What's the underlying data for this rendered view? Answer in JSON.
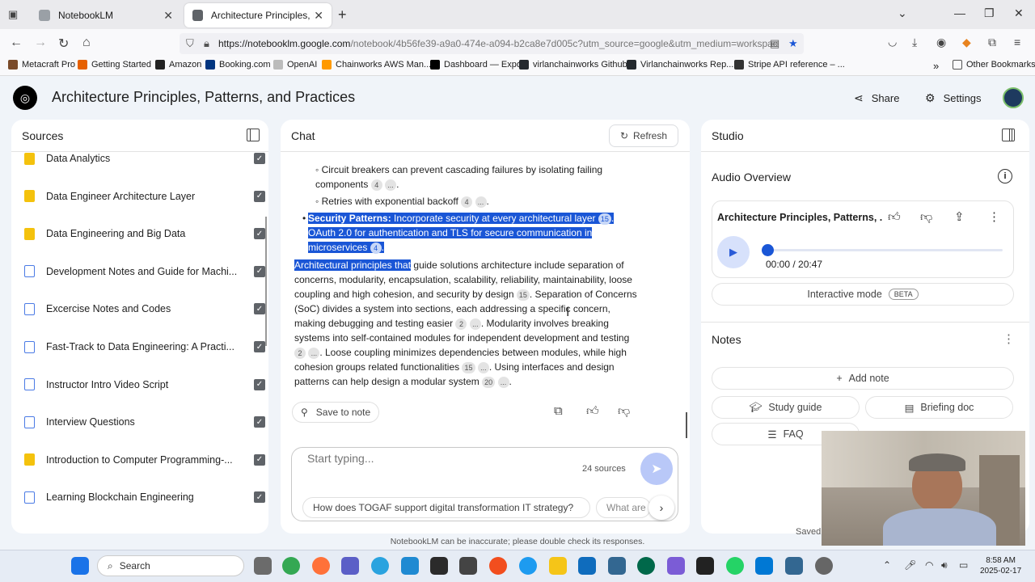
{
  "browser": {
    "tabs": [
      {
        "label": "NotebookLM"
      },
      {
        "label": "Architecture Principles, Patterns"
      }
    ],
    "url_host": "https://notebooklm.google.com",
    "url_rest": "/notebook/4b56fe39-a9a0-474e-a094-b2ca8e7d005c?utm_source=google&utm_medium=workspac",
    "bookmarks": [
      {
        "label": "Metacraft Pro",
        "color": "#7a4b2a"
      },
      {
        "label": "Getting Started",
        "color": "#e66000"
      },
      {
        "label": "Amazon",
        "color": "#222222"
      },
      {
        "label": "Booking.com",
        "color": "#003580"
      },
      {
        "label": "OpenAI",
        "color": "#bbbbbb"
      },
      {
        "label": "Chainworks AWS Man...",
        "color": "#ff9900"
      },
      {
        "label": "Dashboard — Expo",
        "color": "#000000"
      },
      {
        "label": "virlanchainworks Github",
        "color": "#24292e"
      },
      {
        "label": "Virlanchainworks Rep...",
        "color": "#24292e"
      },
      {
        "label": "Stripe API reference – ...",
        "color": "#333333"
      }
    ],
    "other_bookmarks": "Other Bookmarks"
  },
  "app": {
    "title": "Architecture Principles, Patterns, and Practices",
    "share_label": "Share",
    "settings_label": "Settings"
  },
  "sources": {
    "header": "Sources",
    "items": [
      {
        "label": "Data Analytics",
        "icon": "yellow"
      },
      {
        "label": "Data Engineer Architecture Layer",
        "icon": "yellow"
      },
      {
        "label": "Data Engineering and Big Data",
        "icon": "yellow"
      },
      {
        "label": "Development Notes and Guide for Machi...",
        "icon": "doc"
      },
      {
        "label": "Excercise Notes and Codes",
        "icon": "doc"
      },
      {
        "label": "Fast-Track to Data Engineering: A Practi...",
        "icon": "doc"
      },
      {
        "label": "Instructor Intro Video Script",
        "icon": "doc"
      },
      {
        "label": "Interview Questions",
        "icon": "doc"
      },
      {
        "label": "Introduction to Computer Programming-...",
        "icon": "yellow"
      },
      {
        "label": "Learning Blockchain Engineering",
        "icon": "doc"
      }
    ]
  },
  "chat": {
    "header": "Chat",
    "refresh_label": "Refresh",
    "bullet1": "Circuit breakers can prevent cascading failures by isolating failing components",
    "bullet1_cite": "4",
    "bullet2": "Retries with exponential backoff",
    "bullet2_cite": "4",
    "more": "...",
    "security_title": "Security Patterns:",
    "security_text": "Incorporate security at every architectural layer",
    "security_cite1": "15",
    "security_text2": "OAuth 2.0 for authentication and TLS for secure communication in microservices",
    "security_cite2": "4",
    "para_selected": "Architectural principles that",
    "para_1": "guide solutions architecture include separation of concerns, modularity, encapsulation, scalability, reliability, maintainability, loose coupling and high cohesion, and security by design",
    "para_cite1": "15",
    "para_2": ". Separation of Concerns (SoC) divides a system into sections, each addressing a specific concern, making debugging and testing easier",
    "para_cite2": "2",
    "para_3": ". Modularity involves breaking systems into self-contained modules for independent development and testing",
    "para_cite3": "2",
    "para_4": ". Loose coupling minimizes dependencies between modules, while high cohesion groups related functionalities",
    "para_cite4": "15",
    "para_5": ". Using interfaces and design patterns can help design a modular system",
    "para_cite5": "20",
    "save_label": "Save to note",
    "input_placeholder": "Start typing...",
    "source_count": "24 sources",
    "suggestions": [
      "How does TOGAF support digital transformation IT strategy?",
      "What are"
    ],
    "disclaimer": "NotebookLM can be inaccurate; please double check its responses."
  },
  "studio": {
    "header": "Studio",
    "audio_overview": "Audio Overview",
    "audio_title": "Architecture Principles, Patterns, ...",
    "time": "00:00 / 20:47",
    "progress": 0,
    "interactive_mode": "Interactive mode",
    "beta": "BETA",
    "notes": "Notes",
    "add_note": "Add note",
    "study_guide": "Study guide",
    "briefing_doc": "Briefing doc",
    "faq": "FAQ",
    "saved": "Saved"
  },
  "taskbar": {
    "search": "Search",
    "time": "8:58 AM",
    "date": "2025-02-17"
  }
}
